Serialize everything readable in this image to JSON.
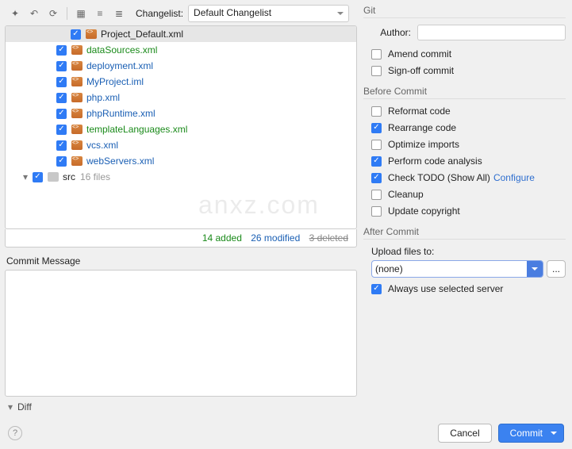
{
  "toolbar": {
    "changelist_label": "Changelist:",
    "changelist_value": "Default Changelist"
  },
  "tree": {
    "root": {
      "name": "Project_Default.xml",
      "status": "plain"
    },
    "files": [
      {
        "name": "dataSources.xml",
        "status": "added"
      },
      {
        "name": "deployment.xml",
        "status": "modified"
      },
      {
        "name": "MyProject.iml",
        "status": "modified"
      },
      {
        "name": "php.xml",
        "status": "modified"
      },
      {
        "name": "phpRuntime.xml",
        "status": "modified"
      },
      {
        "name": "templateLanguages.xml",
        "status": "added"
      },
      {
        "name": "vcs.xml",
        "status": "modified"
      },
      {
        "name": "webServers.xml",
        "status": "modified"
      }
    ],
    "folder": {
      "name": "src",
      "count": "16 files"
    }
  },
  "summary": {
    "added": "14 added",
    "modified": "26 modified",
    "deleted": "3 deleted"
  },
  "commit_message_label": "Commit Message",
  "diff_label": "Diff",
  "git": {
    "section": "Git",
    "author_label": "Author:",
    "author_value": "",
    "amend": {
      "label": "Amend commit",
      "checked": false
    },
    "signoff": {
      "label": "Sign-off commit",
      "checked": false
    }
  },
  "before": {
    "section": "Before Commit",
    "items": [
      {
        "label": "Reformat code",
        "checked": false
      },
      {
        "label": "Rearrange code",
        "checked": true
      },
      {
        "label": "Optimize imports",
        "checked": false
      },
      {
        "label": "Perform code analysis",
        "checked": true
      },
      {
        "label": "Check TODO (Show All)",
        "checked": true,
        "link": "Configure"
      },
      {
        "label": "Cleanup",
        "checked": false
      },
      {
        "label": "Update copyright",
        "checked": false
      }
    ]
  },
  "after": {
    "section": "After Commit",
    "upload_label": "Upload files to:",
    "upload_value": "(none)",
    "always": {
      "label": "Always use selected server",
      "checked": true
    }
  },
  "buttons": {
    "cancel": "Cancel",
    "commit": "Commit"
  },
  "help": "?"
}
